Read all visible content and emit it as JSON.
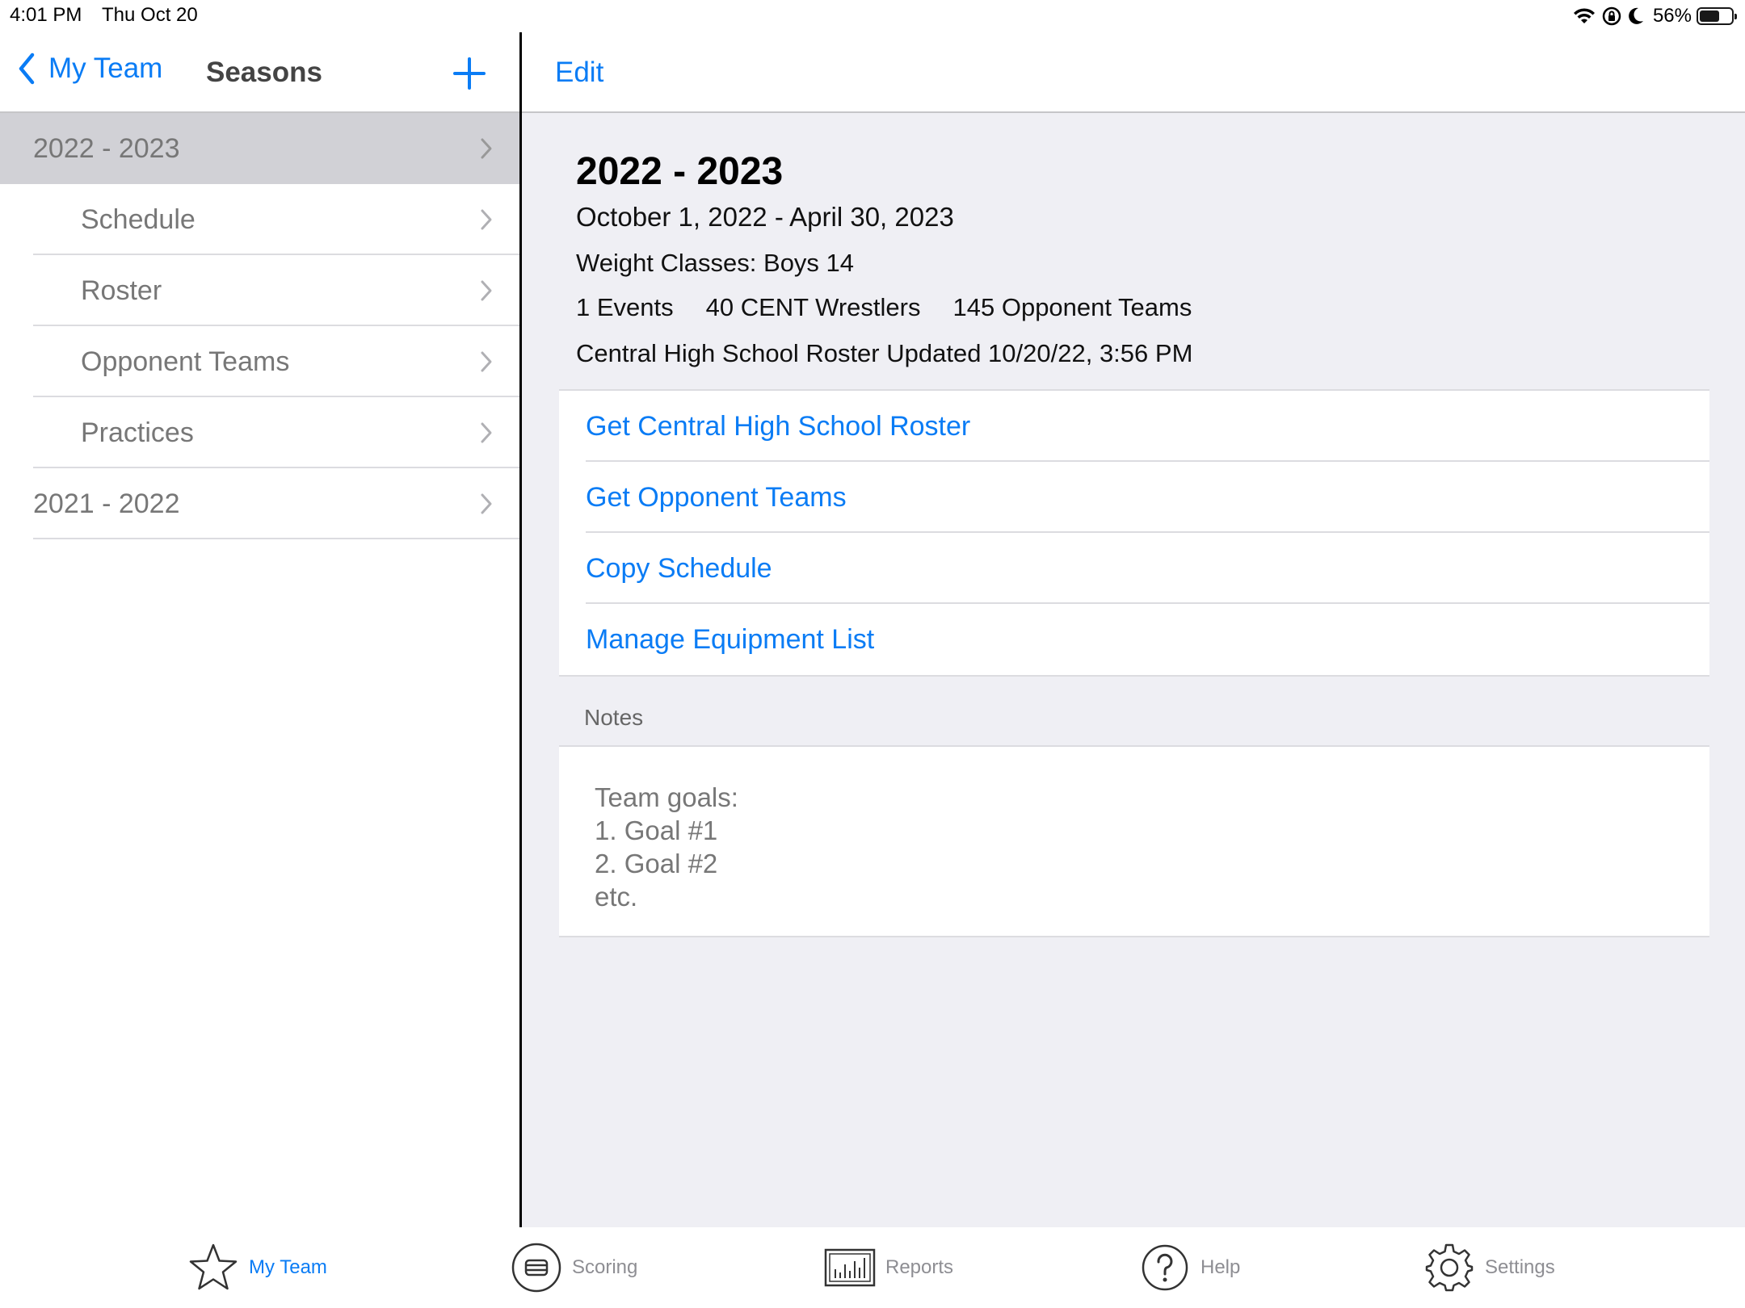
{
  "status_bar": {
    "time": "4:01 PM",
    "date": "Thu Oct 20",
    "battery_percent": "56%",
    "battery_level": 0.56,
    "icons": [
      "wifi-icon",
      "orientation-lock-icon",
      "moon-icon",
      "battery-icon"
    ]
  },
  "sidebar": {
    "back_label": "My Team",
    "title": "Seasons",
    "add_icon": "plus-icon",
    "items": [
      {
        "label": "2022 - 2023",
        "kind": "season",
        "selected": true
      },
      {
        "label": "Schedule",
        "kind": "sub"
      },
      {
        "label": "Roster",
        "kind": "sub"
      },
      {
        "label": "Opponent Teams",
        "kind": "sub"
      },
      {
        "label": "Practices",
        "kind": "sub"
      },
      {
        "label": "2021 - 2022",
        "kind": "season"
      }
    ]
  },
  "detail": {
    "edit_label": "Edit",
    "title": "2022 - 2023",
    "dates": "October 1, 2022 - April 30, 2023",
    "weight_classes": "Weight Classes: Boys 14",
    "events": "1 Events",
    "wrestlers": "40 CENT Wrestlers",
    "opponents": "145 Opponent Teams",
    "roster_updated": "Central High School Roster Updated 10/20/22, 3:56 PM",
    "actions": [
      "Get Central High School Roster",
      "Get Opponent Teams",
      "Copy Schedule",
      "Manage Equipment List"
    ],
    "notes_header": "Notes",
    "notes_text": "Team goals:\n1.  Goal #1\n2. Goal #2\netc."
  },
  "tabbar": {
    "tabs": [
      {
        "label": "My Team",
        "icon": "star-icon",
        "active": true
      },
      {
        "label": "Scoring",
        "icon": "scoring-icon"
      },
      {
        "label": "Reports",
        "icon": "reports-icon"
      },
      {
        "label": "Help",
        "icon": "help-icon"
      },
      {
        "label": "Settings",
        "icon": "gear-icon"
      }
    ]
  },
  "colors": {
    "accent": "#0a7cf5",
    "selected_row": "#d1d1d6",
    "detail_background": "#efeff4",
    "inactive_tab": "#8e8e93"
  }
}
